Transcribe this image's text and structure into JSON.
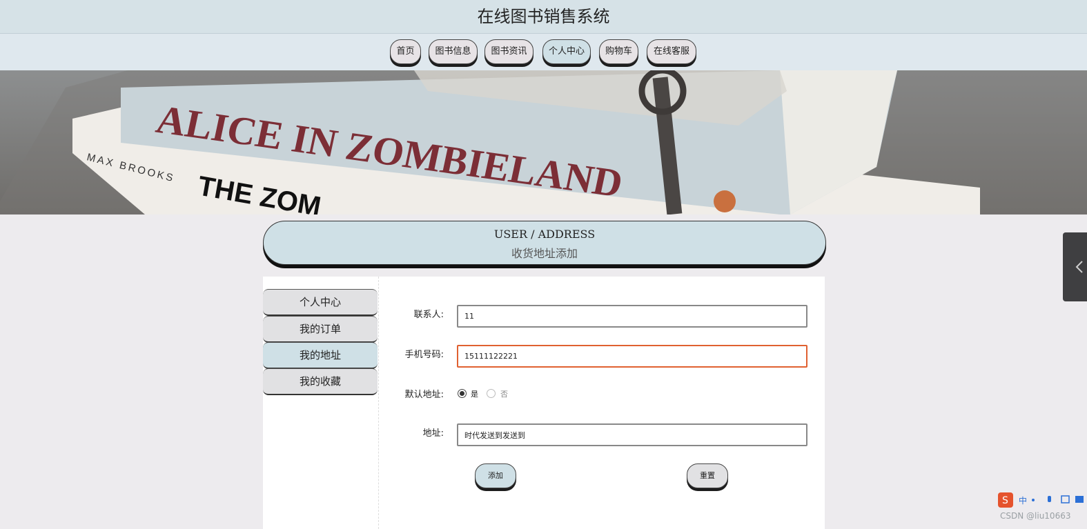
{
  "app": {
    "title": "在线图书销售系统"
  },
  "nav": {
    "items": [
      {
        "label": "首页"
      },
      {
        "label": "图书信息"
      },
      {
        "label": "图书资讯"
      },
      {
        "label": "个人中心"
      },
      {
        "label": "购物车"
      },
      {
        "label": "在线客服"
      }
    ],
    "active": "个人中心"
  },
  "banner": {
    "book_title": "ALICE IN ZOMBIELAND",
    "lower_book_author": "MAX BROOKS",
    "lower_book_title": "THE ZOM"
  },
  "panel": {
    "title_en": "USER / ADDRESS",
    "title_zh": "收货地址添加"
  },
  "sidebar": {
    "items": [
      {
        "label": "个人中心"
      },
      {
        "label": "我的订单"
      },
      {
        "label": "我的地址"
      },
      {
        "label": "我的收藏"
      }
    ],
    "active": "我的地址"
  },
  "form": {
    "contact": {
      "label": "联系人:",
      "value": "11"
    },
    "phone": {
      "label": "手机号码:",
      "value": "15111122221"
    },
    "default": {
      "label": "默认地址:",
      "options": [
        "是",
        "否"
      ],
      "selected": "是"
    },
    "address": {
      "label": "地址:",
      "value": "时代发送到发送到"
    },
    "submit_label": "添加",
    "reset_label": "重置"
  },
  "ime": {
    "label": "中"
  },
  "watermark": "CSDN @liu10663",
  "colors": {
    "accent": "#cfe0e6",
    "focus_border": "#e06030",
    "button_shadow": "#1d1d1d"
  }
}
